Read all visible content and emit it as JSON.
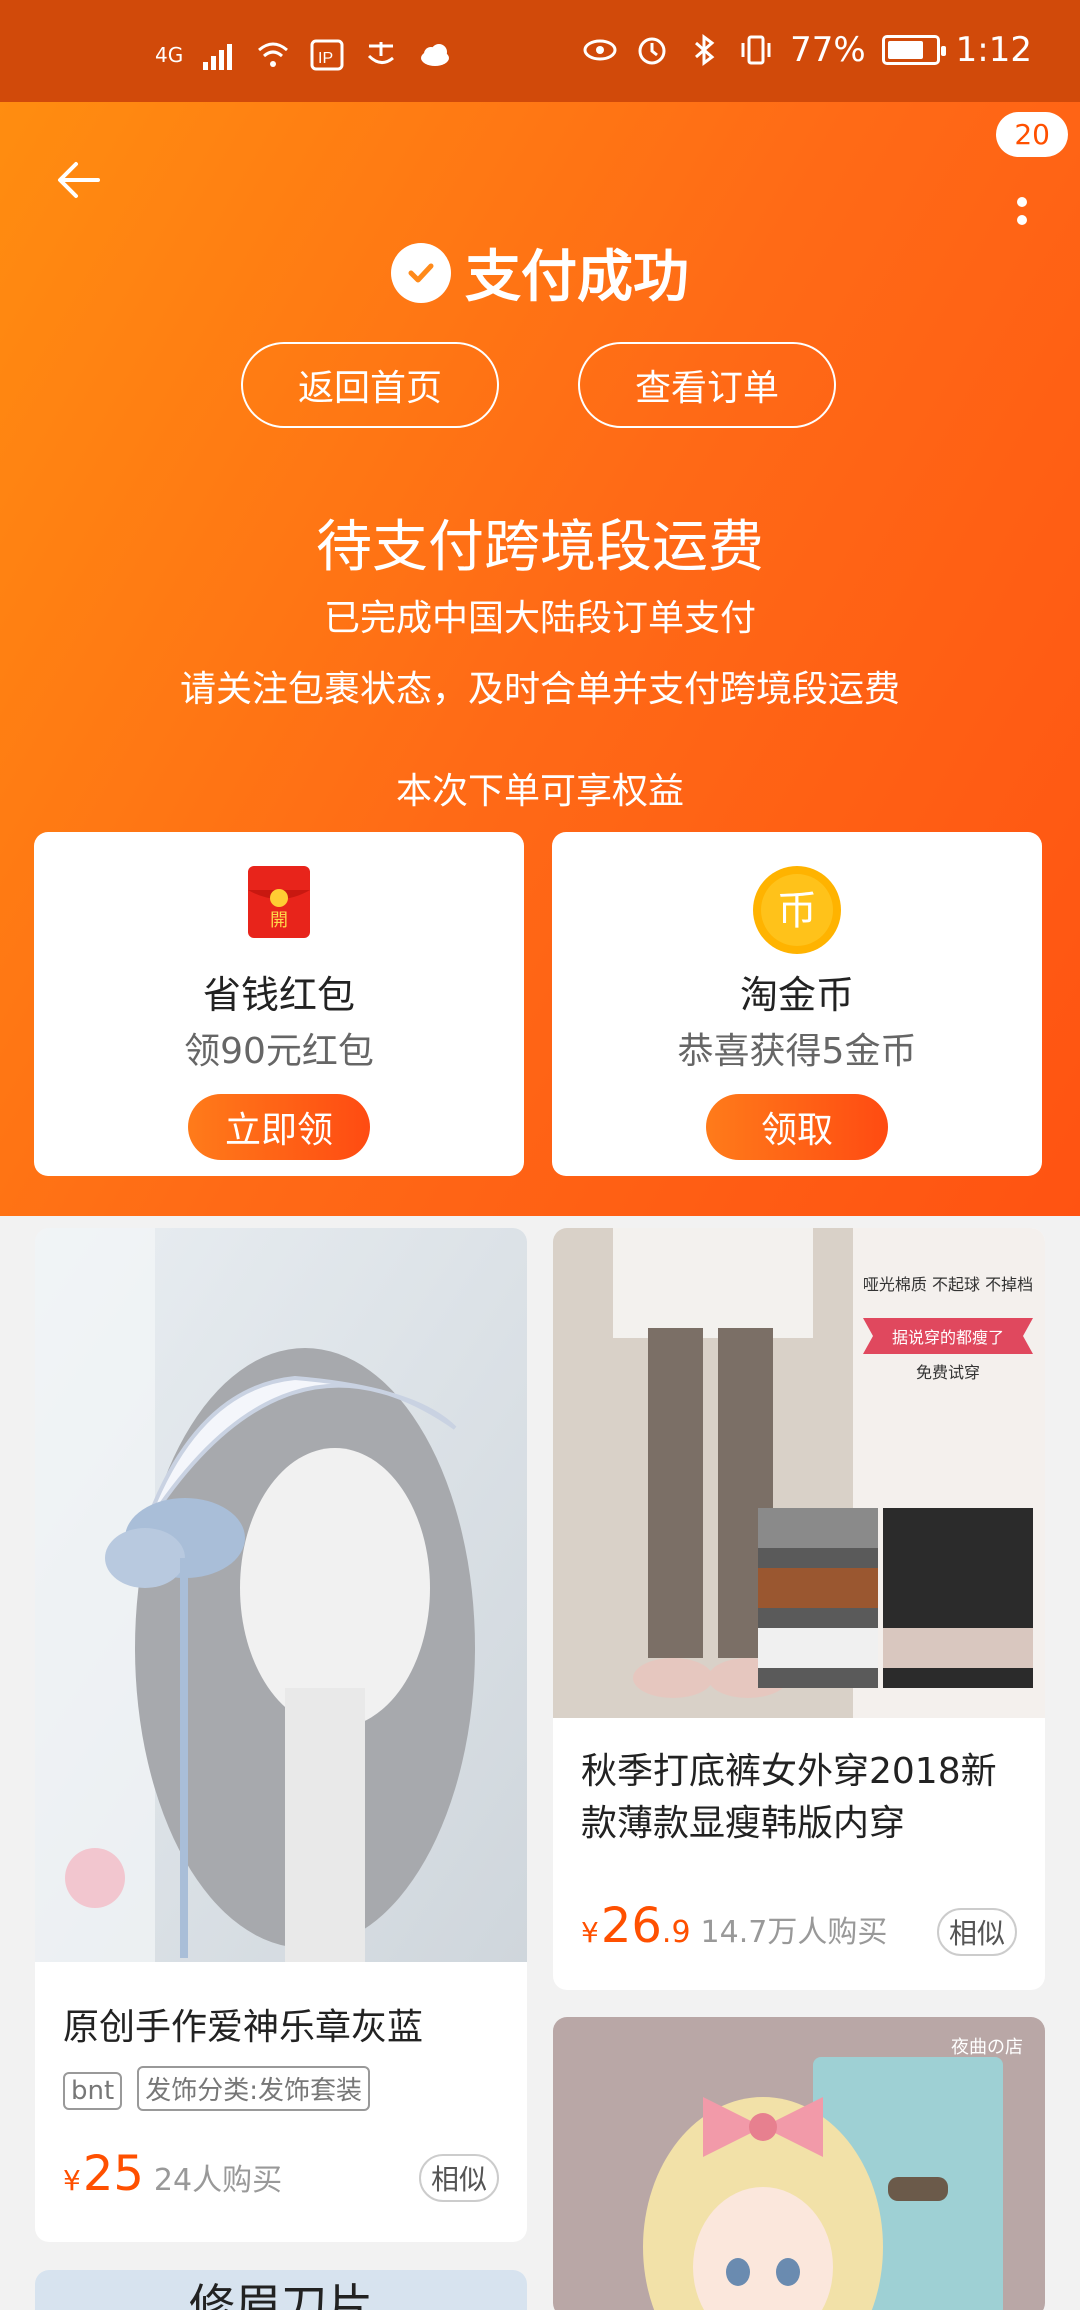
{
  "status_bar": {
    "network": "4G",
    "battery": "77%",
    "battery_level": 0.77,
    "time": "1:12"
  },
  "header": {
    "notification_count": "20",
    "title": "支付成功",
    "buttons": {
      "home": "返回首页",
      "orders": "查看订单"
    }
  },
  "notice": {
    "heading": "待支付跨境段运费",
    "line1": "已完成中国大陆段订单支付",
    "line2": "请关注包裹状态，及时合单并支付跨境段运费"
  },
  "benefits": {
    "title": "本次下单可享权益",
    "items": [
      {
        "name": "省钱红包",
        "desc": "领90元红包",
        "cta": "立即领",
        "icon": "red-envelope-icon",
        "icon_text": "開"
      },
      {
        "name": "淘金币",
        "desc": "恭喜获得5金币",
        "cta": "领取",
        "icon": "gold-coin-icon",
        "icon_text": "币"
      }
    ]
  },
  "products": [
    {
      "title": "原创手作爱神乐章灰蓝",
      "tags": [
        "bnt",
        "发饰分类:发饰套装"
      ],
      "currency": "¥",
      "price_int": "25",
      "price_dec": "",
      "sold": "24人购买",
      "similar": "相似"
    },
    {
      "title": "秋季打底裤女外穿2018新款薄款显瘦韩版内穿",
      "tags": [],
      "currency": "¥",
      "price_int": "26",
      "price_dec": ".9",
      "sold": "14.7万人购买",
      "similar": "相似",
      "image_text": {
        "t1": "哑光棉质 不起球 不掉档",
        "t2": "据说穿的都瘦了",
        "t3": "免费试穿"
      }
    },
    {
      "image_text": {
        "t1": "夜曲の店"
      }
    },
    {
      "image_text": {
        "t1": "修眉刀片"
      }
    }
  ],
  "colors": {
    "accent": "#ff5000",
    "status_bar": "#d14a0a"
  }
}
